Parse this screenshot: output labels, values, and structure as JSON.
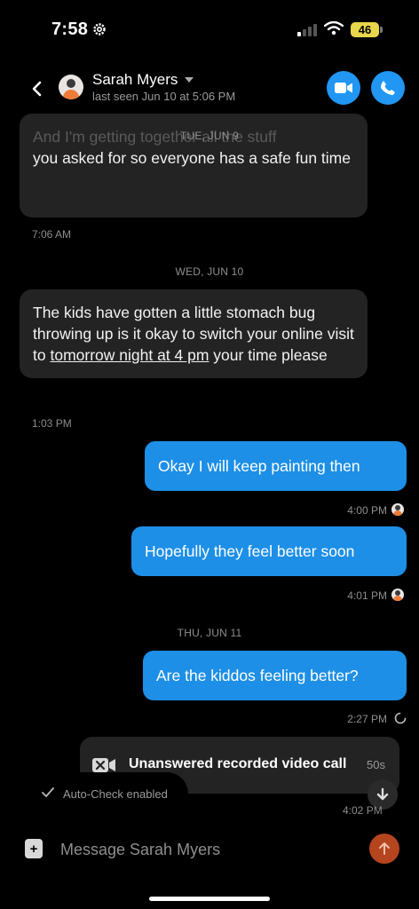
{
  "status_bar": {
    "time": "7:58",
    "battery": "46"
  },
  "header": {
    "contact_name": "Sarah Myers",
    "last_seen": "last seen Jun 10 at 5:06 PM"
  },
  "messages": {
    "day1": "TUE, JUN 9",
    "m1_partial": "And I'm getting together all the stuff",
    "m1_text": "you asked for so everyone has a safe fun time",
    "m1_time": "7:06 AM",
    "day2": "WED, JUN 10",
    "m2_text_a": "The kids have gotten a little stomach bug throwing up is it okay to switch your online visit to ",
    "m2_link": "tomorrow night at 4 pm",
    "m2_text_b": " your time please",
    "m2_time": "1:03 PM",
    "m3_text": "Okay I will keep painting then",
    "m3_time": "4:00 PM",
    "m4_text": "Hopefully they feel better soon",
    "m4_time": "4:01 PM",
    "day3": "THU, JUN 11",
    "m5_text": "Are the kiddos feeling better?",
    "m5_time": "2:27 PM",
    "call_text": "Unanswered recorded video call",
    "call_duration": "50s",
    "call_time": "4:02 PM"
  },
  "auto_check": {
    "label": "Auto-Check enabled"
  },
  "composer": {
    "placeholder": "Message Sarah Myers"
  },
  "icons": {
    "back": "chevron-left-icon",
    "video": "video-camera-icon",
    "phone": "phone-icon",
    "missed_call": "missed-video-call-icon",
    "check": "check-icon",
    "scroll_down": "arrow-down-icon",
    "attach": "plus-icon",
    "send": "arrow-up-icon"
  },
  "colors": {
    "accent_blue": "#1d8fe6",
    "incoming_bubble": "#232323",
    "send_button": "#b5451e",
    "battery": "#e8d64b"
  }
}
